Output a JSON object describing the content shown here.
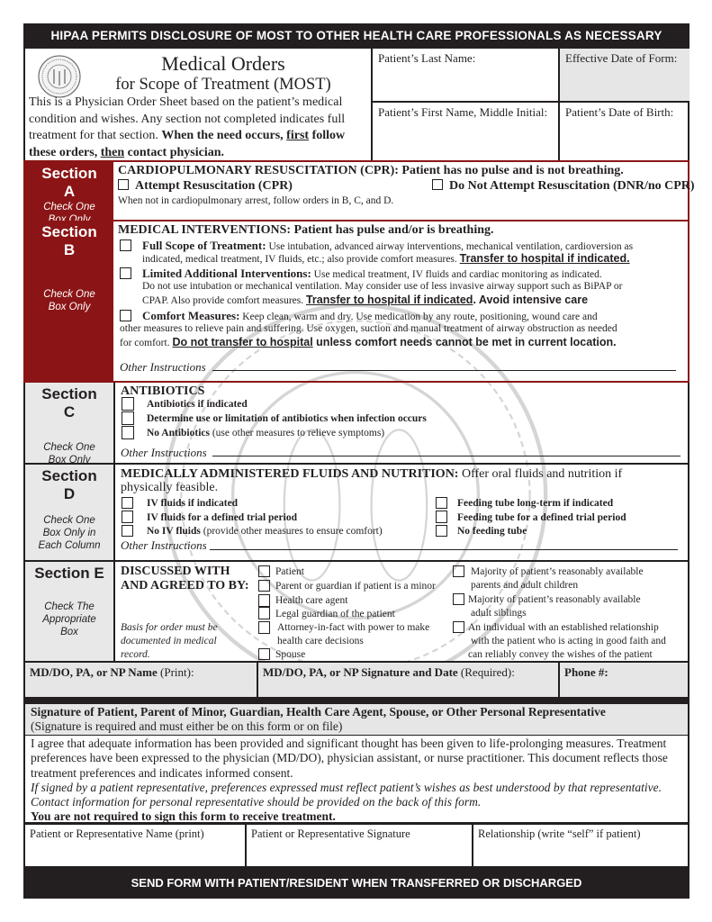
{
  "header": {
    "top_banner": "HIPAA PERMITS DISCLOSURE OF MOST TO OTHER HEALTH CARE PROFESSIONALS AS NECESSARY",
    "seal_icon": "nc-state-seal",
    "title_line1": "Medical Orders",
    "title_line2": "for Scope of Treatment (MOST)",
    "intro_plain": "This is a Physician Order Sheet based on the patient’s medical condition and wishes. Any section not completed indicates full treatment for that section. ",
    "intro_bold_1": "When the need occurs, ",
    "intro_bold_u1": "first",
    "intro_bold_2": " follow these orders, ",
    "intro_bold_u2": "then",
    "intro_bold_3": " contact physician.",
    "fields": {
      "last_name_label": "Patient’s Last Name:",
      "last_name_value": "",
      "effective_date_label": "Effective Date of Form:",
      "effective_date_value": "",
      "first_name_label": "Patient’s First Name, Middle Initial:",
      "first_name_value": "",
      "dob_label": "Patient’s Date of Birth:",
      "dob_value": ""
    }
  },
  "sections": {
    "a": {
      "label": "Section",
      "letter": "A",
      "note": "Check One Box Only",
      "heading": "CARDIOPULMONARY RESUSCITATION (CPR):  Patient has no pulse and is not breathing.",
      "option1": "Attempt Resuscitation (CPR)",
      "option2": "Do Not Attempt Resuscitation (DNR/no CPR)",
      "footnote": "When not in cardiopulmonary arrest, follow orders in B, C, and D.",
      "option1_checked": false,
      "option2_checked": false
    },
    "b": {
      "label": "Section",
      "letter": "B",
      "note": "Check One Box Only",
      "heading": "MEDICAL INTERVENTIONS:  Patient has pulse and/or is breathing.",
      "options": [
        {
          "title": "Full Scope of Treatment:",
          "line1": " Use intubation, advanced airway interventions, mechanical ventilation, cardioversion as",
          "line2": "indicated, medical treatment, IV fluids, etc.; also provide comfort measures.  ",
          "emph": "Transfer to hospital if indicated.",
          "checked": false
        },
        {
          "title": "Limited Additional Interventions:",
          "line1": " Use medical treatment, IV fluids and cardiac monitoring as indicated.",
          "line2": "Do not use intubation or mechanical ventilation. May consider use of less invasive airway support such as BiPAP or",
          "line3": "CPAP. Also provide comfort measures. ",
          "emph": "Transfer to hospital if indicated",
          "emph2": ". Avoid intensive care",
          "checked": false
        },
        {
          "title": "Comfort Measures:",
          "line1": " Keep clean, warm and dry.  Use medication by any route, positioning, wound care and",
          "line2": "other measures to relieve pain and suffering. Use oxygen, suction and manual treatment of airway obstruction as needed",
          "line3": "for comfort. ",
          "emph": "Do not transfer to hospital",
          "emph2": " unless comfort needs cannot be met in current location.",
          "checked": false
        }
      ],
      "other_label": "Other Instructions",
      "other_value": ""
    },
    "c": {
      "label": "Section",
      "letter": "C",
      "note": "Check One Box Only",
      "heading": "ANTIBIOTICS",
      "options": [
        {
          "label": "Antibiotics if indicated",
          "extra": "",
          "checked": false
        },
        {
          "label": "Determine use or limitation of antibiotics when infection occurs",
          "extra": "",
          "checked": false
        },
        {
          "label": "No Antibiotics",
          "extra": " (use other measures to relieve symptoms)",
          "checked": false
        }
      ],
      "other_label": "Other Instructions",
      "other_value": ""
    },
    "d": {
      "label": "Section",
      "letter": "D",
      "note": "Check One Box Only in Each Column",
      "heading": "MEDICALLY ADMINISTERED FLUIDS AND NUTRITION:",
      "heading_rest": "  Offer oral fluids and nutrition if",
      "heading_line2": "physically feasible.",
      "left_options": [
        {
          "label": "IV fluids if indicated",
          "extra": "",
          "checked": false
        },
        {
          "label": "IV fluids for a defined trial period",
          "extra": "",
          "checked": false
        },
        {
          "label": "No IV fluids",
          "extra": " (provide other measures to ensure comfort)",
          "checked": false
        }
      ],
      "right_options": [
        {
          "label": "Feeding tube long-term if indicated",
          "checked": false
        },
        {
          "label": "Feeding tube for a defined trial period",
          "checked": false
        },
        {
          "label": "No feeding tube",
          "checked": false
        }
      ],
      "other_label": "Other Instructions",
      "other_value": ""
    },
    "e": {
      "label": "Section E",
      "note": "Check The Appropriate Box",
      "heading_line1": "DISCUSSED WITH",
      "heading_line2": "AND AGREED TO BY:",
      "basis_note": "Basis for order must be documented in medical record.",
      "left_options": [
        {
          "line1": "Patient",
          "checked": false
        },
        {
          "line1": "Parent or guardian if patient is a minor",
          "checked": false
        },
        {
          "line1": "Health care agent",
          "checked": false
        },
        {
          "line1": "Legal guardian of the patient",
          "checked": false
        },
        {
          "line1": "Attorney-in-fact with power to make",
          "line2": "health care decisions",
          "checked": false
        },
        {
          "line1": "Spouse",
          "checked": false
        }
      ],
      "right_options": [
        {
          "line1": "Majority of patient’s reasonably available",
          "line2": "parents and adult children",
          "checked": false
        },
        {
          "line1": "Majority of patient’s reasonably available",
          "line2": "adult siblings",
          "checked": false
        },
        {
          "line1": "An individual with an established relationship",
          "line2": "with the patient who is acting in good faith and",
          "line3": "can reliably convey the wishes of the patient",
          "checked": false
        }
      ]
    }
  },
  "physician": {
    "name_label_bold": "MD/DO, PA, or NP Name",
    "name_label_rest": " (Print):",
    "name_value": "",
    "signature_label_bold": "MD/DO, PA, or NP Signature and Date",
    "signature_label_rest": " (Required):",
    "signature_value": "",
    "phone_label": "Phone #:",
    "phone_value": ""
  },
  "representative": {
    "heading": "Signature of Patient, Parent of Minor, Guardian, Health Care Agent, Spouse, or Other Personal Representative",
    "subheading": "(Signature is required and must either be on this form or on file)",
    "agree_text": "I agree that adequate information has been provided and significant thought has been given to life-prolonging measures. Treatment preferences have been expressed to the physician (MD/DO), physician assistant, or nurse practitioner. This document reflects those treatment preferences and indicates informed consent.",
    "italic_text": "If signed by a patient representative, preferences expressed must reflect patient’s wishes as best understood by that representative.  Contact information for personal representative should be provided on the back of this form.",
    "bold_text": "You are not required to sign this form to receive treatment.",
    "name_label": "Patient or Representative Name (print)",
    "name_value": "",
    "signature_label": "Patient or Representative Signature",
    "signature_value": "",
    "relationship_label": "Relationship (write “self” if patient)",
    "relationship_value": ""
  },
  "footer": {
    "banner": "SEND FORM WITH PATIENT/RESIDENT WHEN TRANSFERRED OR DISCHARGED"
  },
  "colors": {
    "section_red": "#8b1516",
    "dark_bar": "#231f20",
    "gray_fill": "#e6e6e6"
  }
}
